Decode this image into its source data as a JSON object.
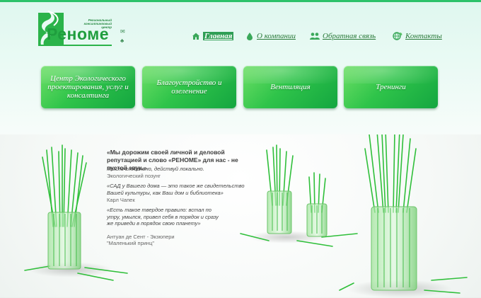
{
  "logo": {
    "name": "Реноме",
    "tagline": "Региональный консалтинговый центр"
  },
  "utility": [
    {
      "icon": "envelope-icon",
      "symbol": "✉"
    },
    {
      "icon": "sitemap-icon",
      "symbol": "♣"
    }
  ],
  "nav": [
    {
      "label": "Главная",
      "icon": "house-icon",
      "active": true
    },
    {
      "label": "О компании",
      "icon": "leaf-drop-icon",
      "active": false
    },
    {
      "label": "Обратная связь",
      "icon": "people-icon",
      "active": false
    },
    {
      "label": "Контакты",
      "icon": "globe-icon",
      "active": false
    }
  ],
  "tiles": [
    {
      "label": "Центр Экологического проектирования, услуг и консалтинга"
    },
    {
      "label": "Благоустройство и озеленение"
    },
    {
      "label": "Вентиляция"
    },
    {
      "label": "Тренинги"
    }
  ],
  "quotes": {
    "main": "«Мы дорожим своей личной и деловой репутацией и слово «РЕНОМЕ» для нас - не пустой звук.»",
    "q1": "Мысли глобально, действуй локально.",
    "q1_author": "Экологический позунг",
    "q2": "«САД у Вашего дома — это такое же свидетельство Вашей культуры, как Ваш дом и библиотека»",
    "q2_author": "Карл Чапек",
    "q3": "«Есть такое твердое правило: встал по утру, умылся, привел себя в порядок и сразу же приведи в порядок свою планету»",
    "q3_author": "Антуан де Сент - Экзюпери",
    "q3_source": "\"Маленький принц\""
  },
  "colors": {
    "accent": "#2cc26a",
    "tile": "#2fc44a",
    "link": "#2a7a3a",
    "grass": "#2fbf3a"
  }
}
